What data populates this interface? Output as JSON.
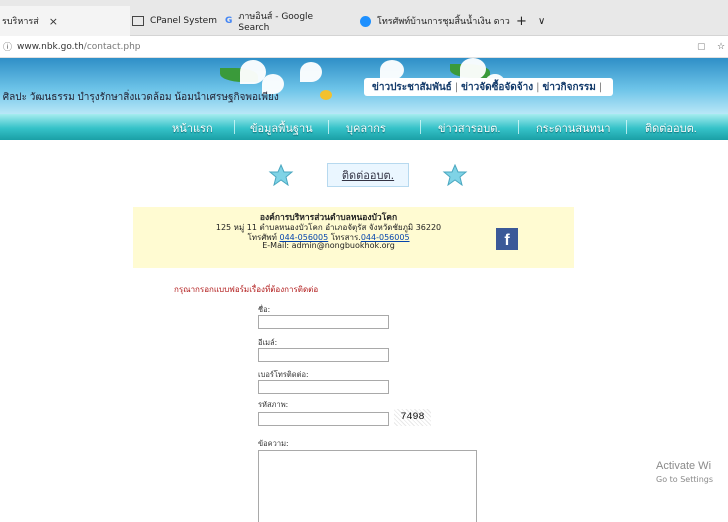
{
  "browser": {
    "tabs": [
      {
        "label": "รบริหารส่",
        "icon": "tab-icon",
        "active": true,
        "close": "×"
      },
      {
        "label": "CPanel System",
        "icon": "window-icon",
        "active": false
      },
      {
        "label": "ภาษอินส์ - Google Search",
        "icon": "google-icon",
        "active": false
      },
      {
        "label": "โทรศัพท์บ้านการชุมสิ้นน้ำเงิน ดาว",
        "icon": "cortana-icon",
        "active": false
      }
    ],
    "new_tab": "+",
    "dropdown": "∨",
    "address": {
      "domain": "www.nbk.go.th",
      "path": "/contact.php"
    },
    "info_icon": "ⓘ",
    "reader_icon": "▢",
    "favorite_icon": "☆"
  },
  "banner": {
    "left_text": "ิ ศิลปะ วัฒนธรรม  บำรุงรักษาสิ่งแวดล้อม  น้อมนำเศรษฐกิจพอเพียง",
    "links": [
      "ข่าวประชาสัมพันธ์",
      "ข่าวจัดซื้อจัดจ้าง",
      "ข่าวกิจกรรม"
    ]
  },
  "nav": {
    "items": [
      "หน้าแรก",
      "ข้อมูลพื้นฐาน",
      "บุคลากร",
      "ข่าวสารอบต.",
      "กระดานสนทนา",
      "ติดต่ออบต."
    ]
  },
  "contact": {
    "title": "ติดต่ออบต.",
    "org_name": "องค์การบริหารส่วนตำบลหนองบัวโคก",
    "address": "125 หมู่ 11 ตำบลหนองบัวโคก อำเภอจัตุรัส จังหวัดชัยภูมิ 36220",
    "phone_label": "โทรศัพท์",
    "phone": "044-056005",
    "fax_label": "โทรสาร.",
    "fax": "044-056005",
    "email": "E-Mail: admin@nongbuokhok.org",
    "facebook_glyph": "f"
  },
  "form": {
    "prompt": "กรุณากรอกแบบฟอร์มเรื่องที่ต้องการติดต่อ",
    "name_label": "ชื่อ:",
    "email_label": "อีเมล์:",
    "phone_label": "เบอร์โทรติดต่อ:",
    "captcha_label": "รหัสภาพ:",
    "captcha_text": "7498",
    "message_label": "ข้อความ:"
  },
  "windows": {
    "activate_title": "Activate Wi",
    "activate_sub": "Go to Settings"
  },
  "colors": {
    "nav_teal": "#35c2c8",
    "banner_blue": "#2f8fc7",
    "info_bg": "#fffbd2",
    "prompt_red": "#b21c1c",
    "facebook_blue": "#3b5998"
  }
}
